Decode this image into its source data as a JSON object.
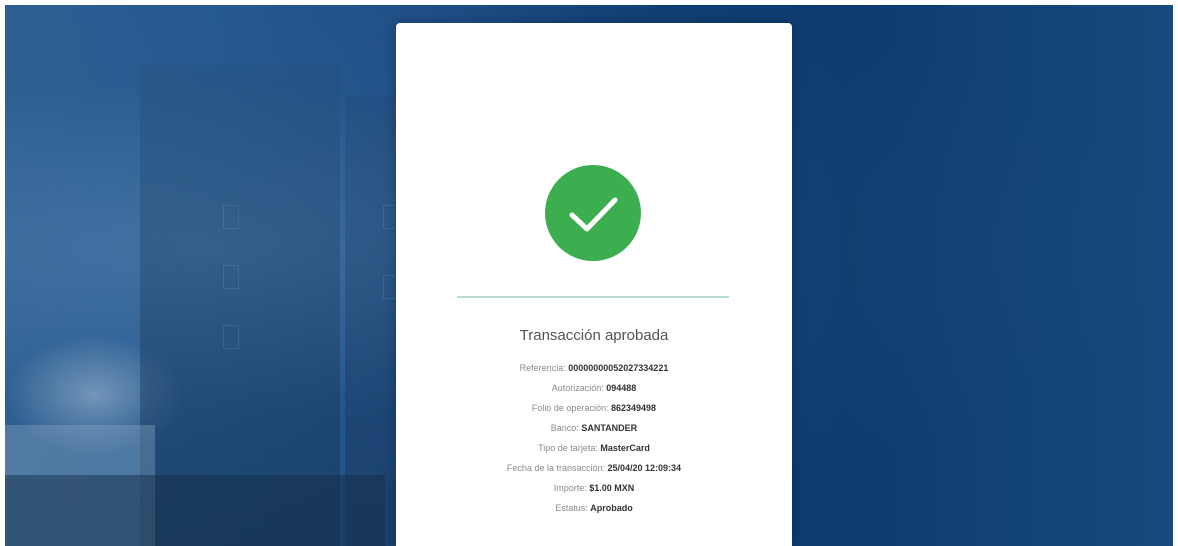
{
  "receipt": {
    "status_icon": "check-circle-icon",
    "title": "Transacción aprobada",
    "rows": [
      {
        "label": "Referencia:",
        "value": "00000000052027334221"
      },
      {
        "label": "Autorización:",
        "value": "094488"
      },
      {
        "label": "Folio de operación:",
        "value": "862349498"
      },
      {
        "label": "Banco:",
        "value": "SANTANDER"
      },
      {
        "label": "Tipo de tarjeta:",
        "value": "MasterCard"
      },
      {
        "label": "Fecha de la transacción:",
        "value": "25/04/20 12:09:34"
      },
      {
        "label": "Importe:",
        "value": "$1.00 MXN"
      },
      {
        "label": "Estatus:",
        "value": "Aprobado"
      }
    ]
  },
  "colors": {
    "success": "#3cae4f",
    "divider": "#b7ddd6",
    "background": "#103f74"
  }
}
